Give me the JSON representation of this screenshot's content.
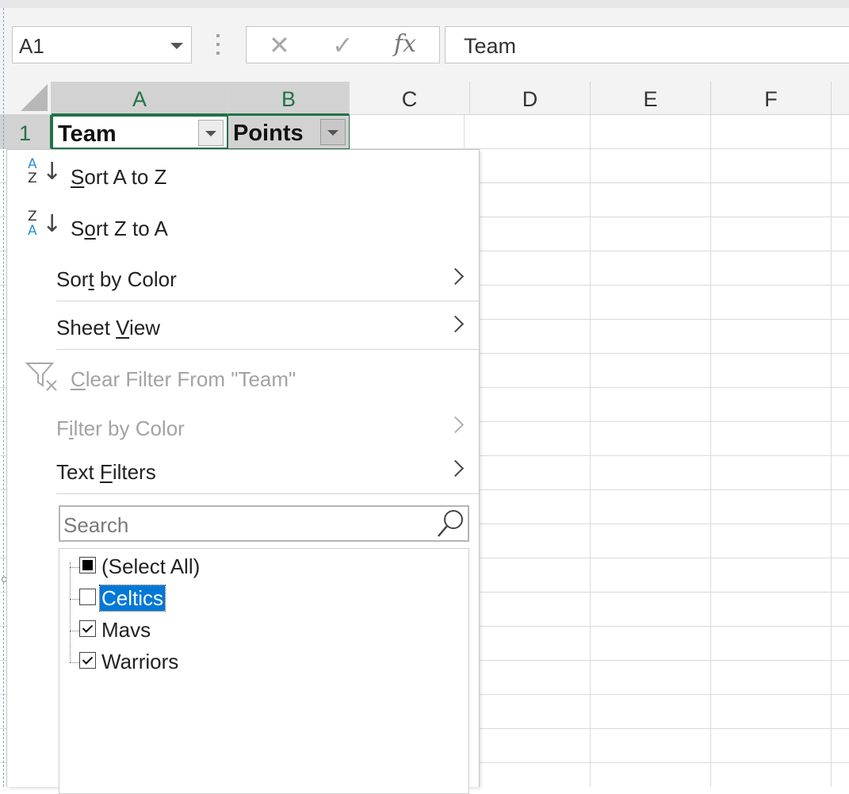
{
  "formula_bar": {
    "name_box": "A1",
    "cancel_glyph": "✕",
    "enter_glyph": "✓",
    "fx_label": "fx",
    "content": "Team"
  },
  "columns": [
    "A",
    "B",
    "C",
    "D",
    "E",
    "F"
  ],
  "rows": [
    "1"
  ],
  "cells": {
    "A1": "Team",
    "B1": "Points"
  },
  "filter_menu": {
    "sort_a_to_z": {
      "u": "S",
      "rest": "ort A to Z",
      "icon_top": "A",
      "icon_bottom": "Z"
    },
    "sort_z_to_a": {
      "pre": "S",
      "u": "o",
      "rest": "rt Z to A",
      "icon_top": "Z",
      "icon_bottom": "A"
    },
    "sort_by_color": {
      "pre": "Sor",
      "u": "t",
      "rest": " by Color"
    },
    "sheet_view": {
      "pre": "Sheet ",
      "u": "V",
      "rest": "iew"
    },
    "clear_filter": {
      "u": "C",
      "rest": "lear Filter From \"Team\"",
      "disabled": true
    },
    "filter_by_color": {
      "pre": "F",
      "u": "i",
      "rest": "lter by Color",
      "disabled": true
    },
    "text_filters": {
      "pre": "Text ",
      "u": "F",
      "rest": "ilters"
    },
    "search_placeholder": "Search",
    "values": [
      {
        "label": "(Select All)",
        "state": "mixed"
      },
      {
        "label": "Celtics",
        "state": "unchecked",
        "focused": true
      },
      {
        "label": "Mavs",
        "state": "checked"
      },
      {
        "label": "Warriors",
        "state": "checked"
      }
    ]
  },
  "colors": {
    "excel_green": "#217346",
    "selection_blue": "#0078d7",
    "sort_icon_blue": "#2f8fd0"
  }
}
